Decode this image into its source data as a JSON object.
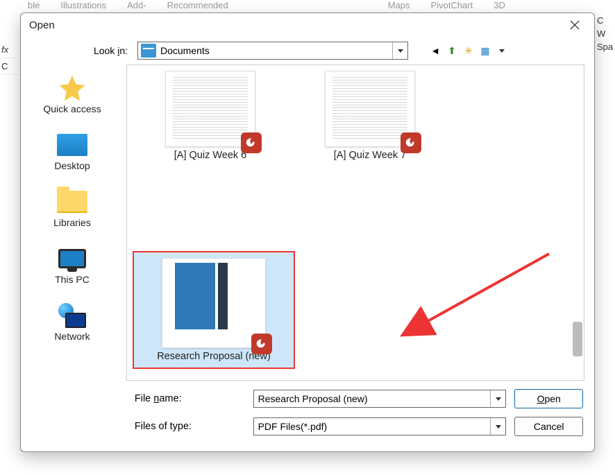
{
  "bg": {
    "ribbon": [
      "ble",
      "Illustrations",
      "Add-",
      "Recommended",
      "Maps",
      "PivotChart",
      "3D"
    ],
    "left": [
      "fx",
      "C"
    ],
    "right": [
      "C",
      "W",
      "Spa"
    ]
  },
  "dialog": {
    "title": "Open",
    "lookin_label_prefix": "Look ",
    "lookin_label_u": "i",
    "lookin_label_suffix": "n:",
    "lookin_value": "Documents"
  },
  "places": [
    {
      "key": "quick-access",
      "label": "Quick access"
    },
    {
      "key": "desktop",
      "label": "Desktop"
    },
    {
      "key": "libraries",
      "label": "Libraries"
    },
    {
      "key": "this-pc",
      "label": "This PC"
    },
    {
      "key": "network",
      "label": "Network"
    }
  ],
  "files": [
    {
      "label": "[A] Quiz Week 6",
      "selected": false,
      "cover": false
    },
    {
      "label": "[A] Quiz Week 7",
      "selected": false,
      "cover": false
    },
    {
      "label": "Research Proposal (new)",
      "selected": true,
      "cover": true
    }
  ],
  "form": {
    "filename_label_prefix": "File ",
    "filename_label_u": "n",
    "filename_label_suffix": "ame:",
    "filename_value": "Research Proposal (new)",
    "filetype_label": "Files of type:",
    "filetype_value": "PDF Files(*.pdf)",
    "open_u": "O",
    "open_suffix": "pen",
    "cancel": "Cancel"
  }
}
